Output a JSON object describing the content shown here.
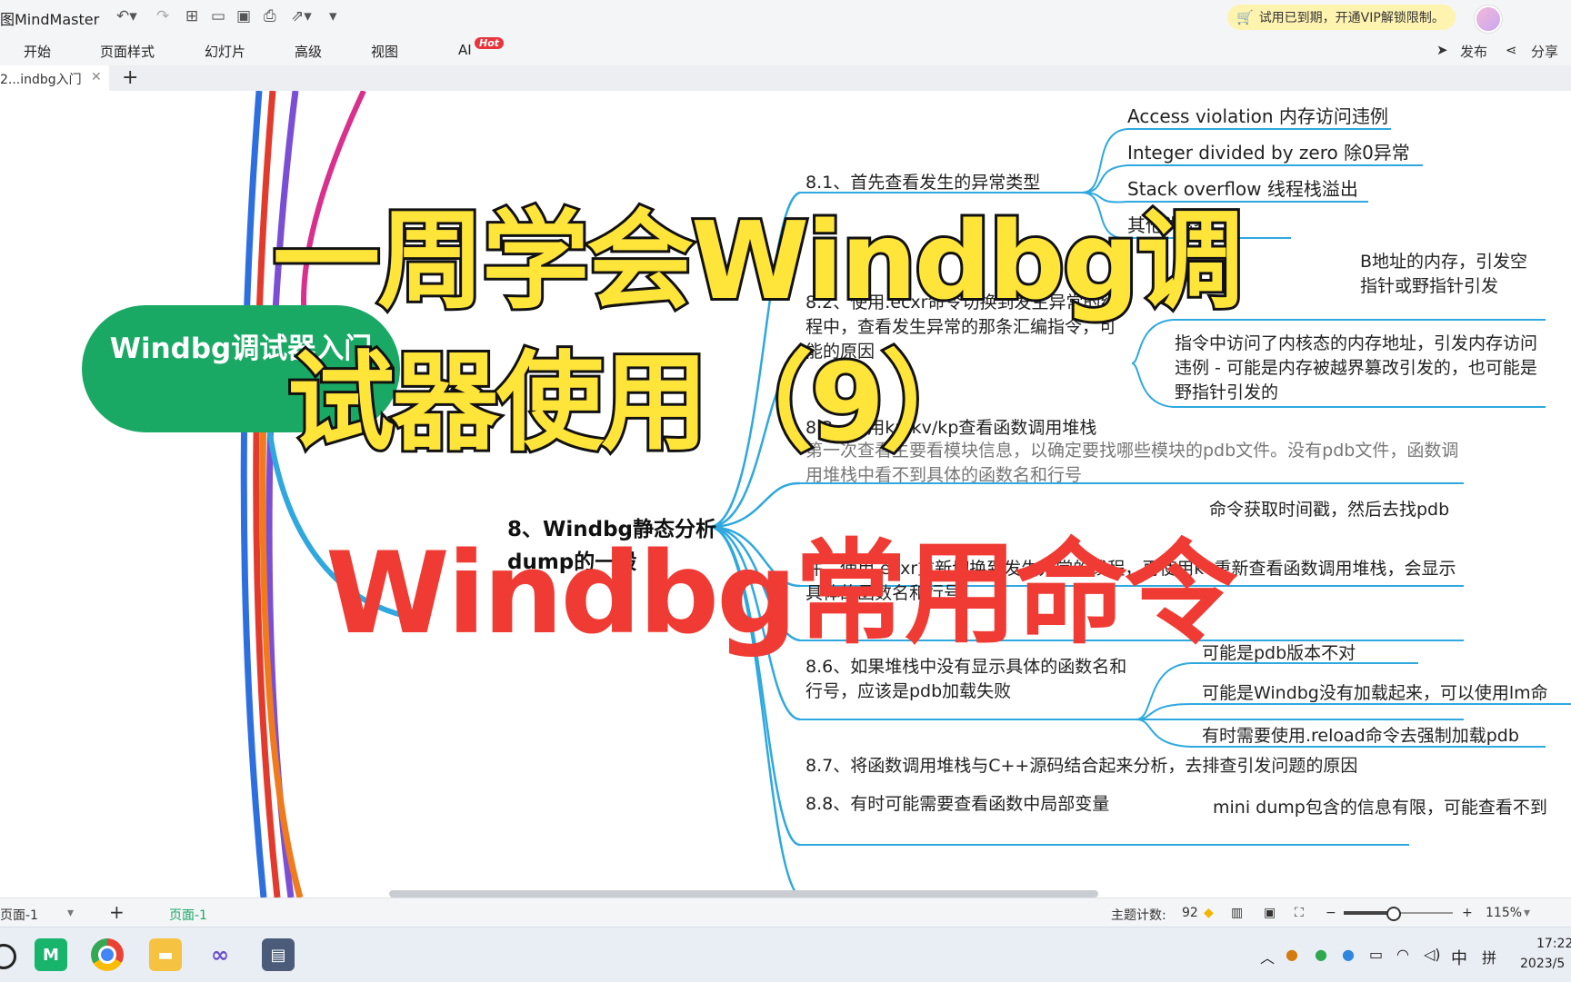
{
  "app": {
    "title": "图MindMaster"
  },
  "vip_banner": "试用已到期，开通VIP解锁限制。",
  "menu": [
    "开始",
    "页面样式",
    "幻灯片",
    "高级",
    "视图",
    "AI"
  ],
  "menu_badge": "Hot",
  "right_tools": {
    "publish": "发布",
    "share": "分享"
  },
  "tab": {
    "label": "2...indbg入门"
  },
  "mindmap": {
    "central": "Windbg调试器入门",
    "node8": "8、Windbg静态分析dump的一般",
    "n81": "8.1、首先查看发生的异常类型",
    "n81_children": [
      "Access violation 内存访问违例",
      "Integer divided by zero 除0异常",
      "Stack overflow 线程栈溢出",
      "其他类型"
    ],
    "n82_partial": "8.2、使用.ecxr命令切换到发生异常的线程中，查看发生异常的那条汇编指令，可能的原因",
    "n82_child1_partial": "B地址的内存，引发空指针或野指针引发",
    "n82_child2": "指令中访问了内核态的内存地址，引发内存访问违例 - 可能是内存被越界篡改引发的，也可能是野指针引发的",
    "n83": "8.3、使用kn/kv/kp查看函数调用堆栈",
    "n83_desc": "第一次查看主要看模块信息，以确定要找哪些模块的pdb文件。没有pdb文件，函数调用堆栈中看不到具体的函数名和行号",
    "n84_partial": "命令获取时间戳，然后去找pdb",
    "n85_partial": "件，使用.ecxr重新切换到发生异常的线程，再使用kv重新查看函数调用堆栈，会显示具体的函数名和行号）",
    "n86": "8.6、如果堆栈中没有显示具体的函数名和行号，应该是pdb加载失败",
    "n86_children": [
      "可能是pdb版本不对",
      "可能是Windbg没有加载起来，可以使用lm命",
      "有时需要使用.reload命令去强制加载pdb"
    ],
    "n87": "8.7、将函数调用堆栈与C++源码结合起来分析，去排查引发问题的原因",
    "n88": "8.8、有时可能需要查看函数中局部变量",
    "n88_child": "mini dump包含的信息有限，可能查看不到"
  },
  "overlay": {
    "line1": "一周学会Windbg调",
    "line2": "试器使用（9）",
    "line3": "Windbg常用命令"
  },
  "statusbar": {
    "page_select": "页面-1",
    "page_tab": "页面-1",
    "topic_count_label": "主题计数:",
    "topic_count": "92",
    "zoom": "115%",
    "zoom_level": 0.45
  },
  "taskbar": {
    "ime": "中",
    "ime2": "拼",
    "time": "17:22",
    "date": "2023/5"
  },
  "colors": {
    "accent_green": "#1aa865",
    "branch_blue": "#2ea8df",
    "overlay_yellow": "#ffe43a",
    "overlay_red": "#ef3b33"
  }
}
